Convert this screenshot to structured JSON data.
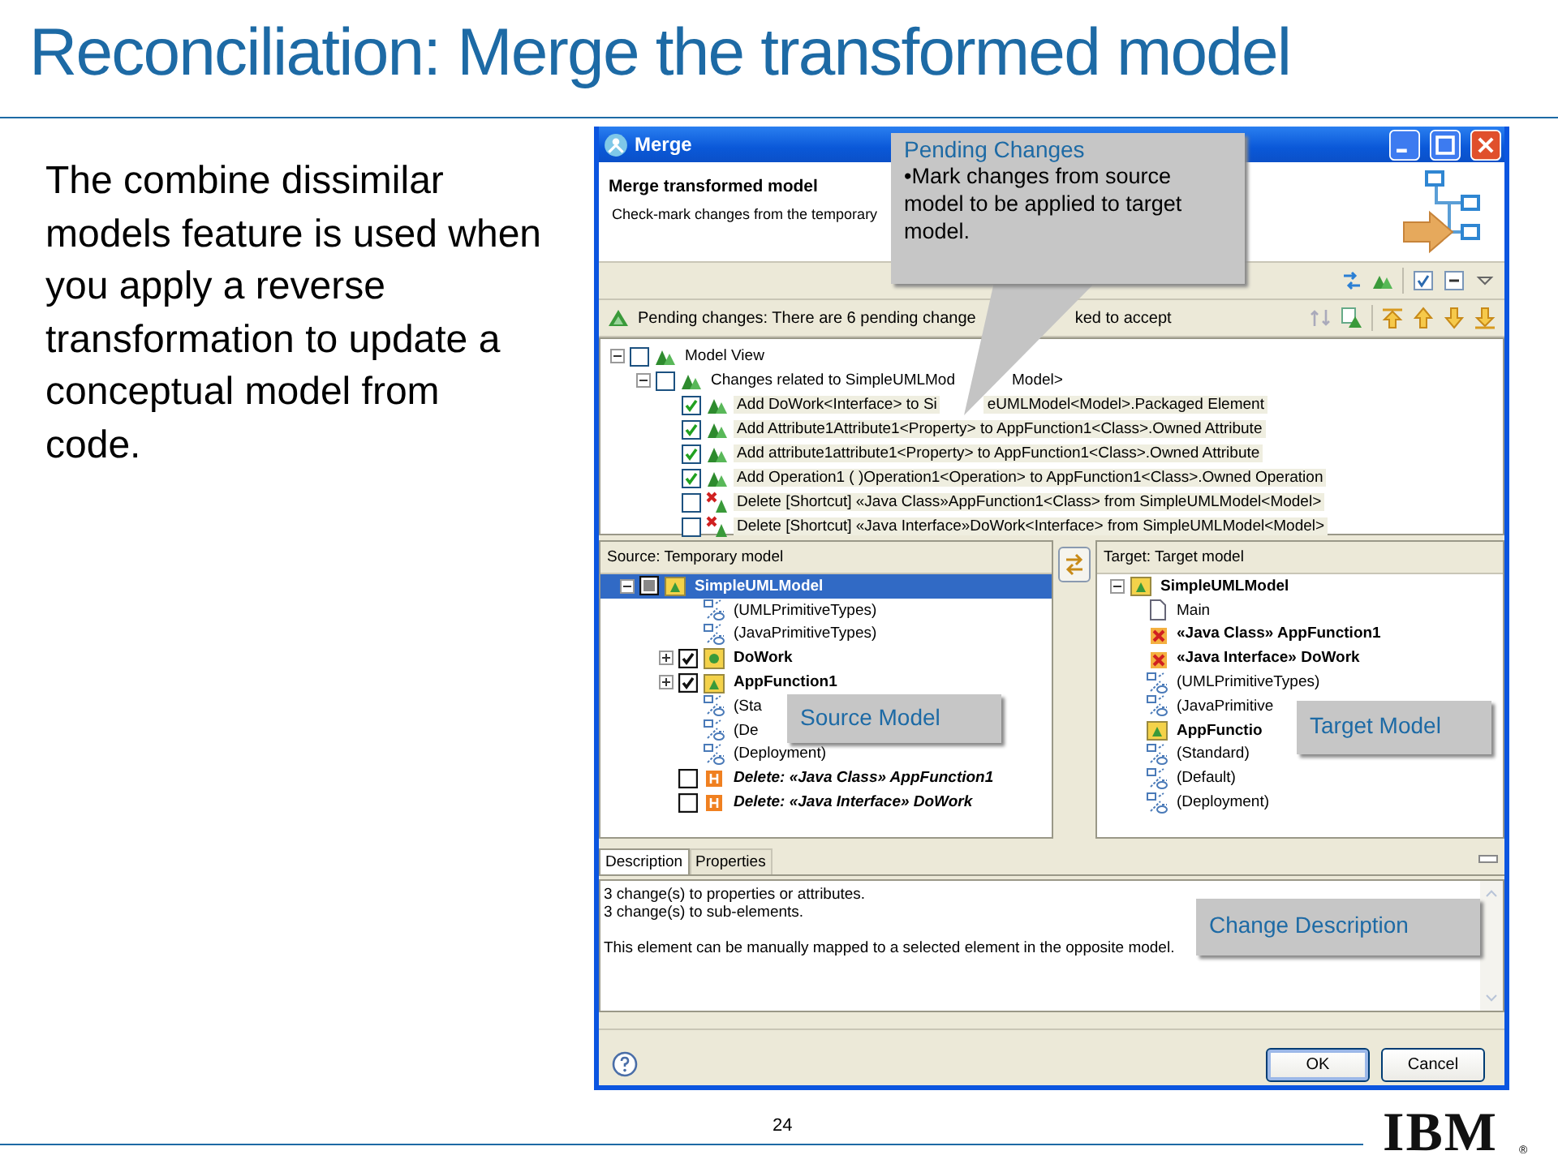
{
  "slide": {
    "title": "Reconciliation: Merge the transformed model",
    "body": "The combine dissimilar models feature is used when you apply a reverse transformation to update a conceptual model from code.",
    "page_number": "24",
    "logo": "IBM",
    "logo_mark": "®"
  },
  "window": {
    "title": "Merge",
    "header_title": "Merge transformed model",
    "header_text": "Check-mark changes from the temporary"
  },
  "pending": {
    "parts": [
      "Pending changes: There are 6 pending change",
      "ked to accept"
    ]
  },
  "change_tree": [
    {
      "kind": "group",
      "parts": [
        "Model View"
      ],
      "checked": false,
      "expanded": true,
      "children": [
        {
          "kind": "group",
          "parts": [
            "Changes related to SimpleUMLMod",
            "Model>"
          ],
          "checked": false,
          "expanded": true,
          "children": [
            {
              "kind": "add",
              "parts": [
                "Add DoWork<Interface> to Si",
                "eUMLModel<Model>.Packaged Element"
              ],
              "checked": true
            },
            {
              "kind": "add",
              "parts": [
                "Add Attribute1Attribute1<Property> to AppFunction1<Class>.Owned Attribute"
              ],
              "checked": true
            },
            {
              "kind": "add",
              "parts": [
                "Add attribute1attribute1<Property> to AppFunction1<Class>.Owned Attribute"
              ],
              "checked": true
            },
            {
              "kind": "add",
              "parts": [
                "Add Operation1 ( )Operation1<Operation> to AppFunction1<Class>.Owned Operation"
              ],
              "checked": true
            },
            {
              "kind": "remove",
              "parts": [
                "Delete [Shortcut] «Java Class»AppFunction1<Class> from SimpleUMLModel<Model>"
              ],
              "checked": false
            },
            {
              "kind": "remove",
              "parts": [
                "Delete [Shortcut] «Java Interface»DoWork<Interface> from SimpleUMLModel<Model>"
              ],
              "checked": false
            }
          ]
        }
      ]
    }
  ],
  "source": {
    "header": "Source: Temporary model",
    "tree": [
      {
        "kind": "model",
        "parts": [
          "SimpleUMLModel"
        ],
        "selected": true,
        "expanded": true,
        "checked": false,
        "mixed": true,
        "children": [
          {
            "kind": "import",
            "parts": [
              "(UMLPrimitiveTypes)"
            ],
            "selected": false
          },
          {
            "kind": "import",
            "parts": [
              "(JavaPrimitiveTypes)"
            ],
            "selected": false
          },
          {
            "kind": "interface",
            "parts": [
              "DoWork"
            ],
            "selected": false,
            "expanded": false,
            "checked": true
          },
          {
            "kind": "class",
            "parts": [
              "AppFunction1"
            ],
            "selected": false,
            "expanded": false,
            "checked": true
          },
          {
            "kind": "import",
            "parts": [
              "(Sta"
            ],
            "selected": false
          },
          {
            "kind": "import",
            "parts": [
              "(De"
            ],
            "selected": false
          },
          {
            "kind": "import",
            "parts": [
              "(Deployment)"
            ],
            "selected": false
          },
          {
            "kind": "delete",
            "parts": [
              "Delete: «Java Class» AppFunction1"
            ],
            "selected": false,
            "checked": false
          },
          {
            "kind": "delete",
            "parts": [
              "Delete: «Java Interface» DoWork"
            ],
            "selected": false,
            "checked": false
          }
        ]
      }
    ]
  },
  "target": {
    "header": "Target: Target model",
    "tree": [
      {
        "kind": "model",
        "parts": [
          "SimpleUMLModel"
        ],
        "selected": false,
        "expanded": true,
        "children": [
          {
            "kind": "diagram",
            "parts": [
              "Main"
            ],
            "selected": false
          },
          {
            "kind": "shortcut",
            "parts": [
              "«Java Class» AppFunction1"
            ],
            "selected": false
          },
          {
            "kind": "shortcut",
            "parts": [
              "«Java Interface» DoWork"
            ],
            "selected": false
          },
          {
            "kind": "import",
            "parts": [
              "(UMLPrimitiveTypes)"
            ],
            "selected": false
          },
          {
            "kind": "import",
            "parts": [
              "(JavaPrimitive"
            ],
            "selected": false
          },
          {
            "kind": "class",
            "parts": [
              "AppFunctio"
            ],
            "selected": false
          },
          {
            "kind": "import",
            "parts": [
              "(Standard)"
            ],
            "selected": false
          },
          {
            "kind": "import",
            "parts": [
              "(Default)"
            ],
            "selected": false
          },
          {
            "kind": "import",
            "parts": [
              "(Deployment)"
            ],
            "selected": false
          }
        ]
      }
    ]
  },
  "tabs": [
    {
      "label": "Description",
      "selected": true
    },
    {
      "label": "Properties",
      "selected": false
    }
  ],
  "description": [
    [
      "3 change(s) to properties or attributes.",
      "3 change(s) to sub-elements."
    ],
    [
      "This element can be manually mapped to a selected element in the opposite model."
    ]
  ],
  "buttons": [
    {
      "label": "OK",
      "default": true
    },
    {
      "label": "Cancel",
      "default": false
    }
  ],
  "callouts": [
    {
      "kind": "pointer",
      "title": "Pending Changes",
      "text": "•Mark changes from source model to be applied to target model."
    },
    {
      "kind": "plain",
      "title": "Source Model"
    },
    {
      "kind": "plain",
      "title": "Target Model"
    },
    {
      "kind": "plain",
      "title": "Change Description"
    }
  ]
}
